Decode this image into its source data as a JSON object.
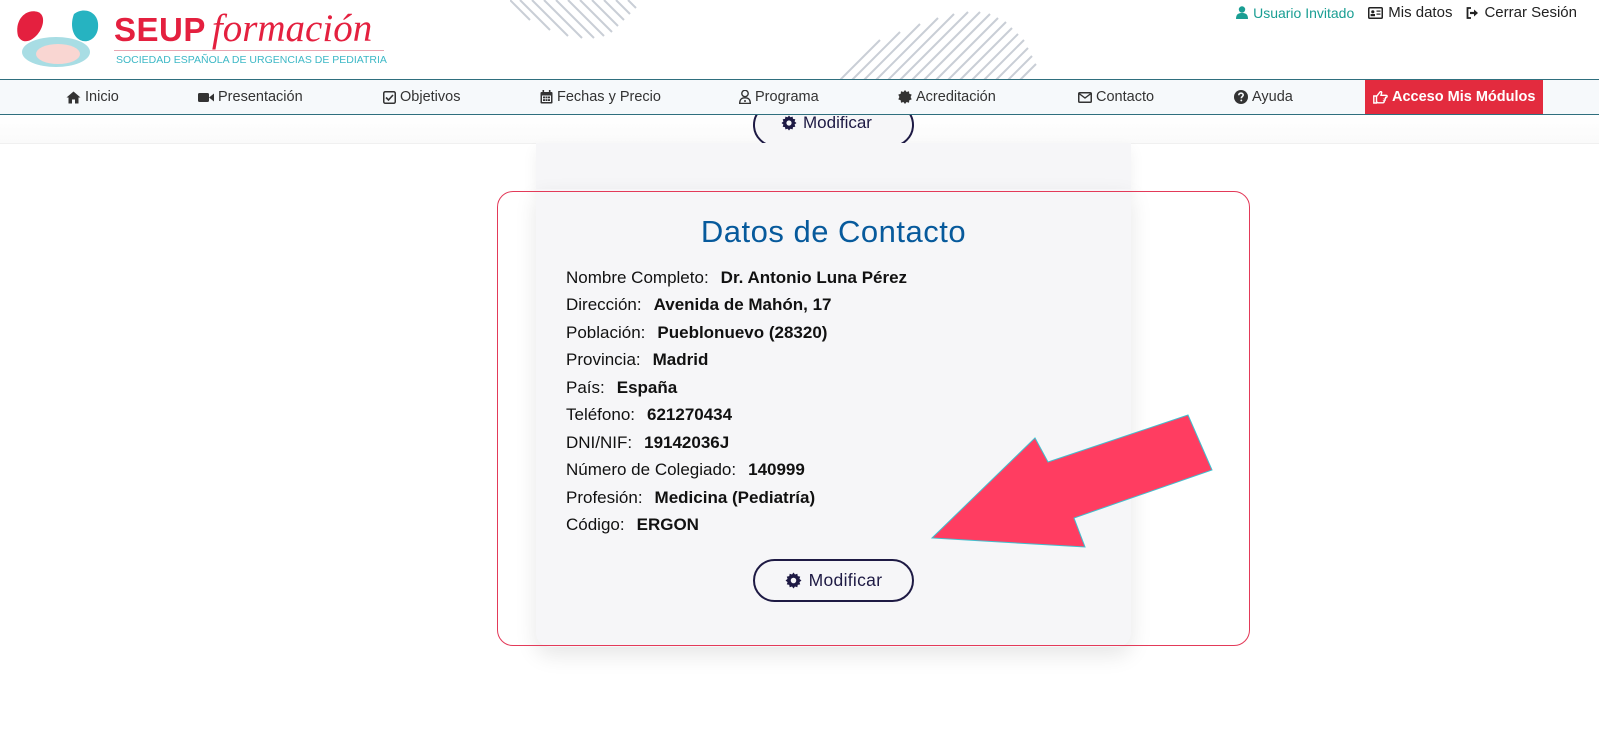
{
  "header": {
    "logo": {
      "brand": "SEUP",
      "tagline": "formación",
      "subtitle": "SOCIEDAD ESPAÑOLA DE URGENCIAS DE PEDIATRIA"
    },
    "user_links": [
      {
        "label": "Usuario Invitado",
        "icon": "user-icon"
      },
      {
        "label": "Mis datos",
        "icon": "id-card-icon"
      },
      {
        "label": "Cerrar Sesión",
        "icon": "sign-out-icon"
      }
    ]
  },
  "nav": {
    "items": [
      {
        "label": "Inicio",
        "icon": "home-icon"
      },
      {
        "label": "Presentación",
        "icon": "video-icon"
      },
      {
        "label": "Objetivos",
        "icon": "check-square-icon"
      },
      {
        "label": "Fechas y Precio",
        "icon": "calendar-icon"
      },
      {
        "label": "Programa",
        "icon": "user-md-icon"
      },
      {
        "label": "Acreditación",
        "icon": "certificate-icon"
      },
      {
        "label": "Contacto",
        "icon": "envelope-icon"
      },
      {
        "label": "Ayuda",
        "icon": "question-circle-icon"
      }
    ],
    "access": {
      "label": "Acceso Mis Módulos",
      "icon": "hand-pointer-icon"
    }
  },
  "card": {
    "top_button_label": "Modificar",
    "title": "Datos de Contacto",
    "fields": [
      {
        "label": "Nombre Completo:",
        "value": "Dr. Antonio Luna Pérez"
      },
      {
        "label": "Dirección:",
        "value": "Avenida de Mahón, 17"
      },
      {
        "label": "Población:",
        "value": "Pueblonuevo (28320)"
      },
      {
        "label": "Provincia:",
        "value": "Madrid"
      },
      {
        "label": "País:",
        "value": "España"
      },
      {
        "label": "Teléfono:",
        "value": "621270434"
      },
      {
        "label": "DNI/NIF:",
        "value": "19142036J"
      },
      {
        "label": "Número de Colegiado:",
        "value": "140999"
      },
      {
        "label": "Profesión:",
        "value": "Medicina (Pediatría)"
      },
      {
        "label": "Código:",
        "value": "ERGON"
      }
    ],
    "button_label": "Modificar"
  },
  "colors": {
    "brand_red": "#e4203f",
    "brand_teal": "#3db8c6",
    "title_blue": "#075a9c",
    "access_red": "#e32b3e",
    "annotation_pink": "#ff3d61"
  }
}
